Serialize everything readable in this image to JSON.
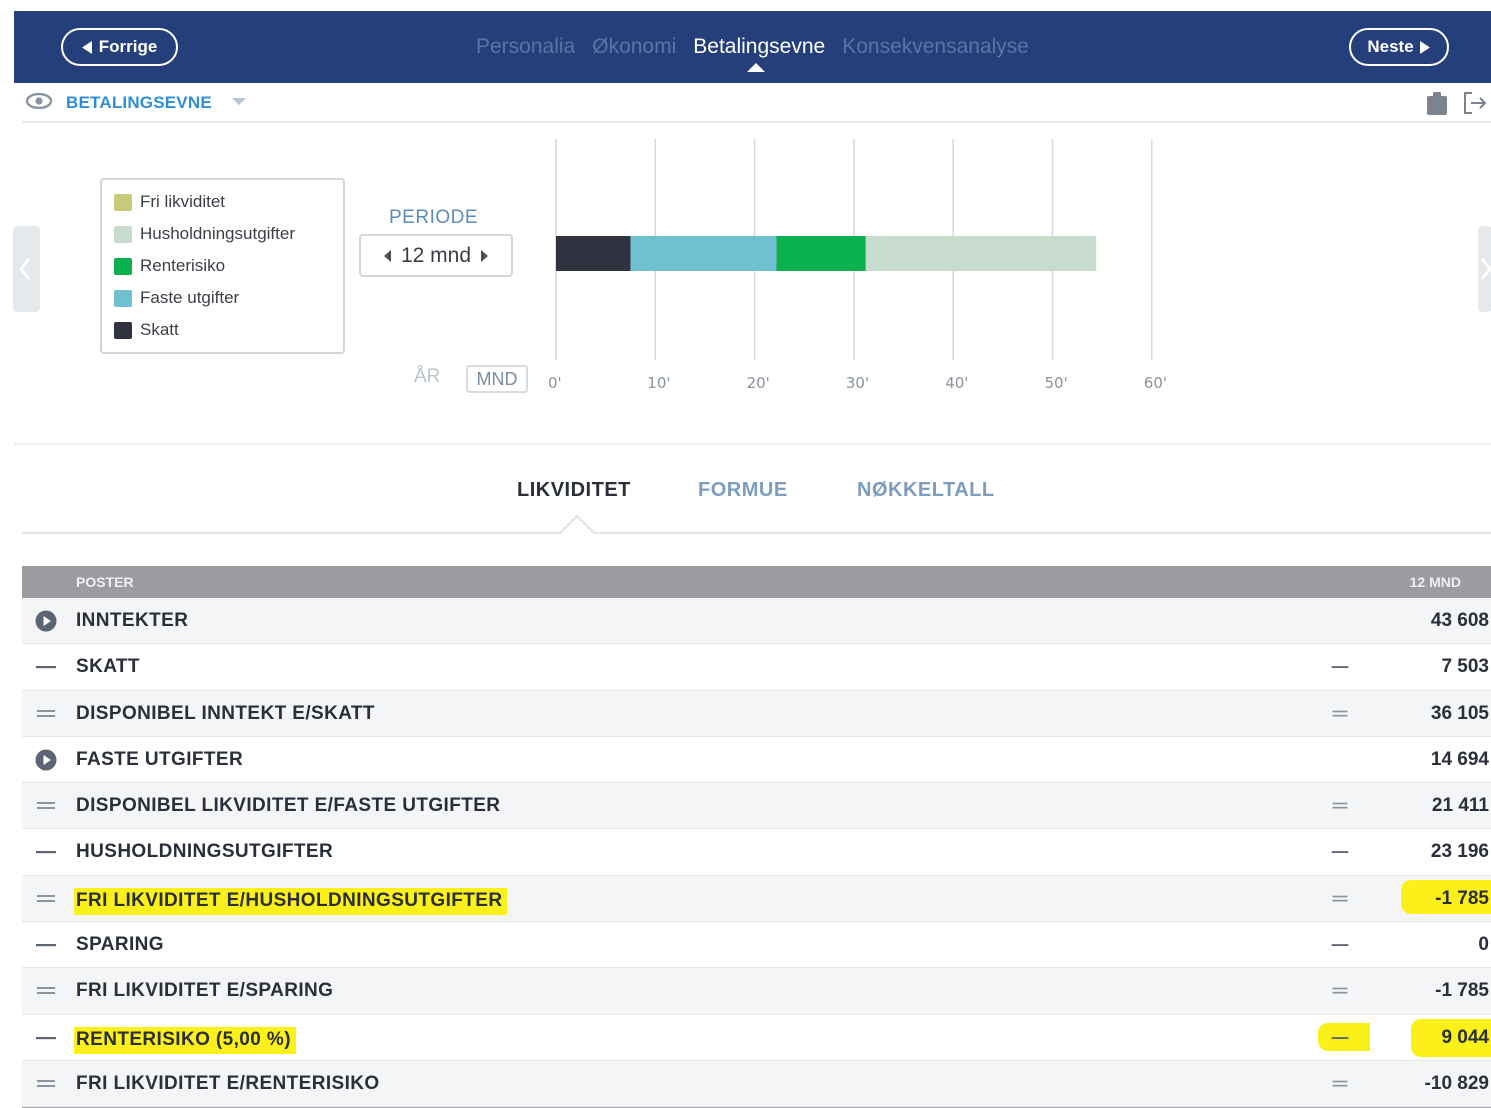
{
  "nav": {
    "prev_label": "Forrige",
    "next_label": "Neste",
    "steps": [
      "Personalia",
      "Økonomi",
      "Betalingsevne",
      "Konsekvensanalyse"
    ],
    "active_step": "Betalingsevne"
  },
  "section": {
    "title": "BETALINGSEVNE"
  },
  "legend": {
    "items": [
      {
        "label": "Fri likviditet",
        "color": "#c9c97a"
      },
      {
        "label": "Husholdningsutgifter",
        "color": "#c7dccf"
      },
      {
        "label": "Renterisiko",
        "color": "#0cb14f"
      },
      {
        "label": "Faste utgifter",
        "color": "#6fc0d0"
      },
      {
        "label": "Skatt",
        "color": "#30333f"
      }
    ]
  },
  "periode": {
    "label": "PERIODE",
    "value": "12 mnd"
  },
  "view_toggle": {
    "year": "ÅR",
    "month": "MND"
  },
  "chart_data": {
    "type": "bar",
    "orientation": "horizontal",
    "stacked": true,
    "xlim": [
      0,
      60
    ],
    "x_ticks": [
      "0'",
      "10'",
      "20'",
      "30'",
      "40'",
      "50'",
      "60'"
    ],
    "grid": true,
    "series": [
      {
        "name": "Skatt",
        "value": 7.5,
        "color": "#30333f"
      },
      {
        "name": "Faste utgifter",
        "value": 14.7,
        "color": "#6fc0d0"
      },
      {
        "name": "Renterisiko",
        "value": 9.0,
        "color": "#0cb14f"
      },
      {
        "name": "Husholdningsutgifter",
        "value": 23.2,
        "color": "#c7dccf"
      }
    ]
  },
  "tabs": [
    "LIKVIDITET",
    "FORMUE",
    "NØKKELTALL"
  ],
  "table": {
    "header_left": "POSTER",
    "header_right": "12 MND",
    "rows": [
      {
        "symbol": "play",
        "label": "INNTEKTER",
        "op": "",
        "value": "43 608",
        "highlight": false
      },
      {
        "symbol": "minus",
        "label": "SKATT",
        "op": "minus",
        "value": "7 503",
        "highlight": false
      },
      {
        "symbol": "equals",
        "label": "DISPONIBEL INNTEKT E/SKATT",
        "op": "equals",
        "value": "36 105",
        "highlight": false
      },
      {
        "symbol": "play",
        "label": "FASTE UTGIFTER",
        "op": "",
        "value": "14 694",
        "highlight": false
      },
      {
        "symbol": "equals",
        "label": "DISPONIBEL LIKVIDITET E/FASTE UTGIFTER",
        "op": "equals",
        "value": "21 411",
        "highlight": false
      },
      {
        "symbol": "minus",
        "label": "HUSHOLDNINGSUTGIFTER",
        "op": "minus",
        "value": "23 196",
        "highlight": false
      },
      {
        "symbol": "equals",
        "label": "FRI LIKVIDITET E/HUSHOLDNINGSUTGIFTER",
        "op": "equals",
        "value": "-1 785",
        "highlight": true
      },
      {
        "symbol": "minus",
        "label": "SPARING",
        "op": "minus",
        "value": "0",
        "highlight": false
      },
      {
        "symbol": "equals",
        "label": "FRI LIKVIDITET E/SPARING",
        "op": "equals",
        "value": "-1 785",
        "highlight": false
      },
      {
        "symbol": "minus",
        "label": "RENTERISIKO (5,00 %)",
        "op": "minus",
        "value": "9 044",
        "highlight": true
      },
      {
        "symbol": "equals",
        "label": "FRI LIKVIDITET E/RENTERISIKO",
        "op": "equals",
        "value": "-10 829",
        "highlight": false
      }
    ]
  }
}
